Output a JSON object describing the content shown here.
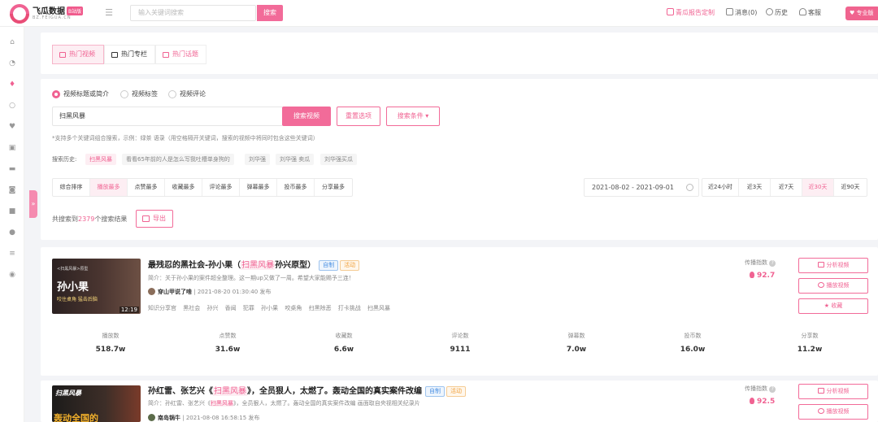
{
  "header": {
    "brand": "飞瓜数据",
    "brand_tag": "B站版",
    "brand_sub": "BZ.FEIGUA.CN",
    "search_placeholder": "输入关键词搜索",
    "search_button": "搜索",
    "links": [
      "青瓜报告定制",
      "消息(0)",
      "历史",
      "客服"
    ],
    "pro": "专业版"
  },
  "tabs": [
    "热门视频",
    "热门专栏",
    "热门话题"
  ],
  "search": {
    "radios": [
      "视频标题或简介",
      "视频标签",
      "视频评论"
    ],
    "keyword": "扫黑风暴",
    "search_btn": "搜索视频",
    "reset_btn": "重置选项",
    "cond_btn": "搜索条件 ▾",
    "hint": "*支持多个关键词组合搜索，示例：绿茶 语录（用空格隔开关键词，搜索的视频中将同时包含这些关键词）",
    "history_label": "搜索历史:",
    "history": [
      "扫黑风暴",
      "看看65年前的人是怎么写我吐槽单身狗的",
      "刘华强",
      "刘华强 卖瓜",
      "刘华强买瓜"
    ]
  },
  "sort": [
    "综合排序",
    "播放最多",
    "点赞最多",
    "收藏最多",
    "评论最多",
    "弹幕最多",
    "投币最多",
    "分享最多"
  ],
  "date_range": "2021-08-02 - 2021-09-01",
  "ranges": [
    "近24小时",
    "近3天",
    "近7天",
    "近30天",
    "近90天"
  ],
  "result": {
    "prefix": "共搜索到",
    "count": "2379",
    "suffix": "个搜索结果",
    "export": "导出"
  },
  "stat_labels": [
    "播放数",
    "点赞数",
    "收藏数",
    "评论数",
    "弹幕数",
    "投币数",
    "分享数"
  ],
  "videos": [
    {
      "title_a": "最残忍的黑社会-孙小果（",
      "title_hl": "扫黑风暴",
      "title_b": "孙兴原型）",
      "tag_self": "自制",
      "tag_act": "活动",
      "desc_label": "简介：",
      "desc": "关于孙小果的案件超全整理。这一期up又做了一周。希望大家能赐予三连！",
      "author": "穿山甲说了啥",
      "date": "| 2021-08-20 01:30:40 发布",
      "tags": "知识分享官 黑社会 孙兴 香闻 犯罪 孙小果 咬桌角 扫黑除恶 打卡挑战 扫黑风暴",
      "thumb_caption": "<扫黑风暴>原型",
      "thumb_name": "孙小果",
      "thumb_sub": "咬住桌角 猛击后脑",
      "duration": "12:19",
      "index_label": "传播指数",
      "index": "92.7",
      "stats": [
        "518.7w",
        "31.6w",
        "6.6w",
        "9111",
        "7.0w",
        "16.0w",
        "11.2w"
      ]
    },
    {
      "title_a": "孙红雷、张艺兴《",
      "title_hl": "扫黑风暴",
      "title_b": "》，全员狠人，太燃了。轰动全国的真实案件改编",
      "tag_self": "自制",
      "tag_act": "活动",
      "desc_label": "简介：",
      "desc_a": "孙红雷、张艺兴《",
      "desc_hl": "扫黑风暴",
      "desc_b": "》，全员狠人，太燃了。轰动全国的真实案件改编 画面取自央视相关纪录片",
      "author": "南岛锅牛",
      "date": "| 2021-08-08 16:58:15 发布",
      "thumb_name": "轰动全国的",
      "index_label": "传播指数",
      "index": "92.5"
    }
  ],
  "actions": [
    "分析视频",
    "播放视频",
    "收藏"
  ]
}
